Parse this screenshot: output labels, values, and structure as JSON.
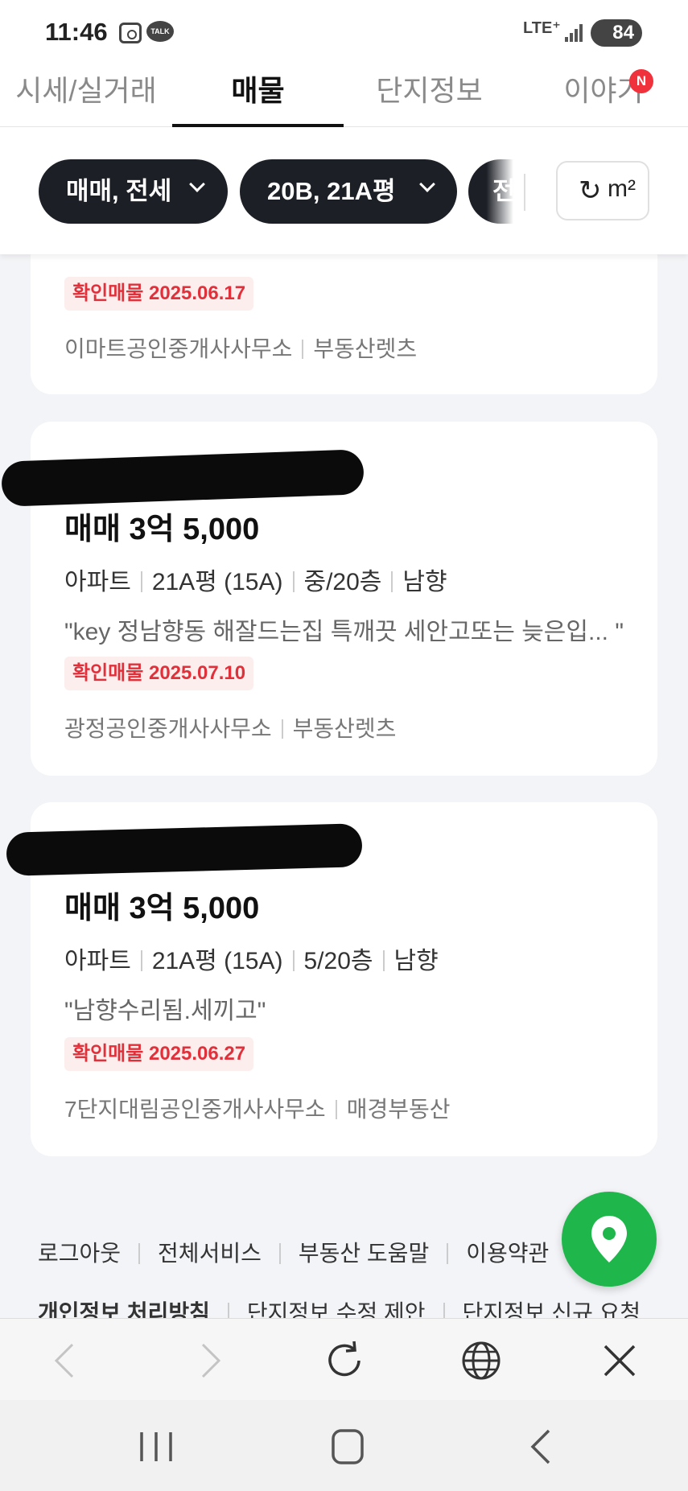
{
  "status_bar": {
    "time": "11:46",
    "talk_label": "TALK",
    "network": "LTE⁺",
    "battery": "84"
  },
  "tabs": [
    {
      "label": "시세/실거래",
      "active": false
    },
    {
      "label": "매물",
      "active": true
    },
    {
      "label": "단지정보",
      "active": false
    },
    {
      "label": "이야기",
      "active": false
    }
  ],
  "tab_badge": "N",
  "filters": {
    "chip_trade": "매매, 전세",
    "chip_size": "20B, 21A평",
    "chip_partial": "전",
    "unit_label": "m²"
  },
  "listings": [
    {
      "cut_text": "\"…\"",
      "confirmed": "확인매물 2025.06.17",
      "agency": "이마트공인중개사사무소",
      "provider": "부동산렛츠"
    },
    {
      "price": "매매 3억 5,000",
      "type": "아파트",
      "size": "21A평 (15A)",
      "floor": "중/20층",
      "direction": "남향",
      "description": "\"key 정남향동 해잘드는집 특깨끗 세안고또는 늦은입... \"",
      "confirmed": "확인매물 2025.07.10",
      "agency": "광정공인중개사사무소",
      "provider": "부동산렛츠"
    },
    {
      "price": "매매 3억 5,000",
      "type": "아파트",
      "size": "21A평 (15A)",
      "floor": "5/20층",
      "direction": "남향",
      "description": "\"남향수리됨.세끼고\"",
      "confirmed": "확인매물 2025.06.27",
      "agency": "7단지대림공인중개사사무소",
      "provider": "매경부동산"
    }
  ],
  "footer": {
    "row1": [
      "로그아웃",
      "전체서비스",
      "부동산 도움말",
      "이용약관"
    ],
    "row2": [
      "개인정보 처리방침",
      "단지정보 수정 제안",
      "단지정보 신규 요청"
    ]
  },
  "colors": {
    "chip_bg": "#1c1f26",
    "badge_red": "#e0303a",
    "map_green": "#1fb74c",
    "notification_red": "#f0323c"
  },
  "icons": {
    "map": "map-pin-icon",
    "refresh": "refresh-icon",
    "browser": [
      "back-arrow-icon",
      "forward-arrow-icon",
      "reload-icon",
      "globe-icon",
      "close-icon"
    ],
    "system": [
      "recent-apps-icon",
      "home-icon",
      "system-back-icon"
    ]
  }
}
